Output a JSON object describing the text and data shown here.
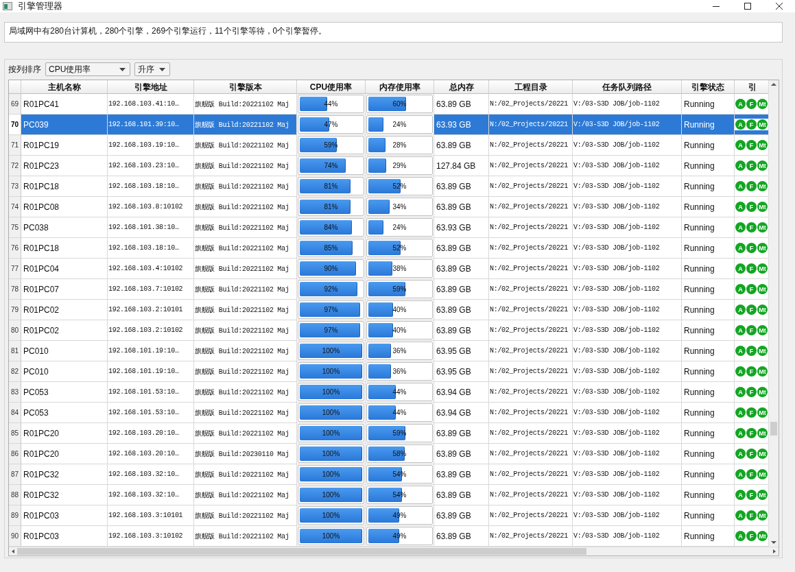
{
  "window": {
    "title": "引擎管理器"
  },
  "summary": "局域网中有280台计算机，280个引擎，269个引擎运行，11个引擎等待，0个引擎暂停。",
  "sort": {
    "label": "按列排序",
    "column": "CPU使用率",
    "order": "升序"
  },
  "table": {
    "columns": [
      "主机名称",
      "引擎地址",
      "引擎版本",
      "CPU使用率",
      "内存使用率",
      "总内存",
      "工程目录",
      "任务队列路径",
      "引擎状态",
      "引"
    ],
    "rows": [
      {
        "number": "69",
        "host": "R01PC41",
        "address": "192.168.103.41:10…",
        "version": "旗舰版 Build:20221102 Maj",
        "cpu": {
          "level": 0.44,
          "text": "44%"
        },
        "memory": {
          "level": 0.6,
          "text": "60%"
        },
        "total": "63.89 GB",
        "project": "N:/02_Projects/20221",
        "queue": "V:/03-S3D JOB/job-1102",
        "status": "Running",
        "badges": [
          "A",
          "F",
          "Mt"
        ],
        "selected": false
      },
      {
        "number": "70",
        "host": "PC039",
        "address": "192.168.101.39:10…",
        "version": "旗舰版 Build:20221102 Maj",
        "cpu": {
          "level": 0.47,
          "text": "47%"
        },
        "memory": {
          "level": 0.24,
          "text": "24%"
        },
        "total": "63.93 GB",
        "project": "N:/02_Projects/20221",
        "queue": "V:/03-S3D JOB/job-1102",
        "status": "Running",
        "badges": [
          "A",
          "F",
          "Mt"
        ],
        "selected": true
      },
      {
        "number": "71",
        "host": "R01PC19",
        "address": "192.168.103.19:10…",
        "version": "旗舰版 Build:20221102 Maj",
        "cpu": {
          "level": 0.59,
          "text": "59%"
        },
        "memory": {
          "level": 0.28,
          "text": "28%"
        },
        "total": "63.89 GB",
        "project": "N:/02_Projects/20221",
        "queue": "V:/03-S3D JOB/job-1102",
        "status": "Running",
        "badges": [
          "A",
          "F",
          "Mt"
        ],
        "selected": false
      },
      {
        "number": "72",
        "host": "R01PC23",
        "address": "192.168.103.23:10…",
        "version": "旗舰版 Build:20221102 Maj",
        "cpu": {
          "level": 0.74,
          "text": "74%"
        },
        "memory": {
          "level": 0.29,
          "text": "29%"
        },
        "total": "127.84 GB",
        "project": "N:/02_Projects/20221",
        "queue": "V:/03-S3D JOB/job-1102",
        "status": "Running",
        "badges": [
          "A",
          "F",
          "Mt"
        ],
        "selected": false
      },
      {
        "number": "73",
        "host": "R01PC18",
        "address": "192.168.103.18:10…",
        "version": "旗舰版 Build:20221102 Maj",
        "cpu": {
          "level": 0.81,
          "text": "81%"
        },
        "memory": {
          "level": 0.52,
          "text": "52%"
        },
        "total": "63.89 GB",
        "project": "N:/02_Projects/20221",
        "queue": "V:/03-S3D JOB/job-1102",
        "status": "Running",
        "badges": [
          "A",
          "F",
          "Mt"
        ],
        "selected": false
      },
      {
        "number": "74",
        "host": "R01PC08",
        "address": "192.168.103.8:10102",
        "version": "旗舰版 Build:20221102 Maj",
        "cpu": {
          "level": 0.81,
          "text": "81%"
        },
        "memory": {
          "level": 0.34,
          "text": "34%"
        },
        "total": "63.89 GB",
        "project": "N:/02_Projects/20221",
        "queue": "V:/03-S3D JOB/job-1102",
        "status": "Running",
        "badges": [
          "A",
          "F",
          "Mt"
        ],
        "selected": false
      },
      {
        "number": "75",
        "host": "PC038",
        "address": "192.168.101.38:10…",
        "version": "旗舰版 Build:20221102 Maj",
        "cpu": {
          "level": 0.84,
          "text": "84%"
        },
        "memory": {
          "level": 0.24,
          "text": "24%"
        },
        "total": "63.93 GB",
        "project": "N:/02_Projects/20221",
        "queue": "V:/03-S3D JOB/job-1102",
        "status": "Running",
        "badges": [
          "A",
          "F",
          "Mt"
        ],
        "selected": false
      },
      {
        "number": "76",
        "host": "R01PC18",
        "address": "192.168.103.18:10…",
        "version": "旗舰版 Build:20221102 Maj",
        "cpu": {
          "level": 0.85,
          "text": "85%"
        },
        "memory": {
          "level": 0.52,
          "text": "52%"
        },
        "total": "63.89 GB",
        "project": "N:/02_Projects/20221",
        "queue": "V:/03-S3D JOB/job-1102",
        "status": "Running",
        "badges": [
          "A",
          "F",
          "Mt"
        ],
        "selected": false
      },
      {
        "number": "77",
        "host": "R01PC04",
        "address": "192.168.103.4:10102",
        "version": "旗舰版 Build:20221102 Maj",
        "cpu": {
          "level": 0.9,
          "text": "90%"
        },
        "memory": {
          "level": 0.38,
          "text": "38%"
        },
        "total": "63.89 GB",
        "project": "N:/02_Projects/20221",
        "queue": "V:/03-S3D JOB/job-1102",
        "status": "Running",
        "badges": [
          "A",
          "F",
          "Mt"
        ],
        "selected": false
      },
      {
        "number": "78",
        "host": "R01PC07",
        "address": "192.168.103.7:10102",
        "version": "旗舰版 Build:20221102 Maj",
        "cpu": {
          "level": 0.92,
          "text": "92%"
        },
        "memory": {
          "level": 0.59,
          "text": "59%"
        },
        "total": "63.89 GB",
        "project": "N:/02_Projects/20221",
        "queue": "V:/03-S3D JOB/job-1102",
        "status": "Running",
        "badges": [
          "A",
          "F",
          "Mt"
        ],
        "selected": false
      },
      {
        "number": "79",
        "host": "R01PC02",
        "address": "192.168.103.2:10101",
        "version": "旗舰版 Build:20221102 Maj",
        "cpu": {
          "level": 0.97,
          "text": "97%"
        },
        "memory": {
          "level": 0.4,
          "text": "40%"
        },
        "total": "63.89 GB",
        "project": "N:/02_Projects/20221",
        "queue": "V:/03-S3D JOB/job-1102",
        "status": "Running",
        "badges": [
          "A",
          "F",
          "Mt"
        ],
        "selected": false
      },
      {
        "number": "80",
        "host": "R01PC02",
        "address": "192.168.103.2:10102",
        "version": "旗舰版 Build:20221102 Maj",
        "cpu": {
          "level": 0.97,
          "text": "97%"
        },
        "memory": {
          "level": 0.4,
          "text": "40%"
        },
        "total": "63.89 GB",
        "project": "N:/02_Projects/20221",
        "queue": "V:/03-S3D JOB/job-1102",
        "status": "Running",
        "badges": [
          "A",
          "F",
          "Mt"
        ],
        "selected": false
      },
      {
        "number": "81",
        "host": "PC010",
        "address": "192.168.101.19:10…",
        "version": "旗舰版 Build:20221102 Maj",
        "cpu": {
          "level": 1,
          "text": "100%"
        },
        "memory": {
          "level": 0.36,
          "text": "36%"
        },
        "total": "63.95 GB",
        "project": "N:/02_Projects/20221",
        "queue": "V:/03-S3D JOB/job-1102",
        "status": "Running",
        "badges": [
          "A",
          "F",
          "Mt"
        ],
        "selected": false
      },
      {
        "number": "82",
        "host": "PC010",
        "address": "192.168.101.19:10…",
        "version": "旗舰版 Build:20221102 Maj",
        "cpu": {
          "level": 1,
          "text": "100%"
        },
        "memory": {
          "level": 0.36,
          "text": "36%"
        },
        "total": "63.95 GB",
        "project": "N:/02_Projects/20221",
        "queue": "V:/03-S3D JOB/job-1102",
        "status": "Running",
        "badges": [
          "A",
          "F",
          "Mt"
        ],
        "selected": false
      },
      {
        "number": "83",
        "host": "PC053",
        "address": "192.168.101.53:10…",
        "version": "旗舰版 Build:20221102 Maj",
        "cpu": {
          "level": 1,
          "text": "100%"
        },
        "memory": {
          "level": 0.44,
          "text": "44%"
        },
        "total": "63.94 GB",
        "project": "N:/02_Projects/20221",
        "queue": "V:/03-S3D JOB/job-1102",
        "status": "Running",
        "badges": [
          "A",
          "F",
          "Mt"
        ],
        "selected": false
      },
      {
        "number": "84",
        "host": "PC053",
        "address": "192.168.101.53:10…",
        "version": "旗舰版 Build:20221102 Maj",
        "cpu": {
          "level": 1,
          "text": "100%"
        },
        "memory": {
          "level": 0.44,
          "text": "44%"
        },
        "total": "63.94 GB",
        "project": "N:/02_Projects/20221",
        "queue": "V:/03-S3D JOB/job-1102",
        "status": "Running",
        "badges": [
          "A",
          "F",
          "Mt"
        ],
        "selected": false
      },
      {
        "number": "85",
        "host": "R01PC20",
        "address": "192.168.103.20:10…",
        "version": "旗舰版 Build:20221102 Maj",
        "cpu": {
          "level": 1,
          "text": "100%"
        },
        "memory": {
          "level": 0.59,
          "text": "59%"
        },
        "total": "63.89 GB",
        "project": "N:/02_Projects/20221",
        "queue": "V:/03-S3D JOB/job-1102",
        "status": "Running",
        "badges": [
          "A",
          "F",
          "Mt"
        ],
        "selected": false
      },
      {
        "number": "86",
        "host": "R01PC20",
        "address": "192.168.103.20:10…",
        "version": "旗舰版 Build:20230110 Maj",
        "cpu": {
          "level": 1,
          "text": "100%"
        },
        "memory": {
          "level": 0.58,
          "text": "58%"
        },
        "total": "63.89 GB",
        "project": "N:/02_Projects/20221",
        "queue": "V:/03-S3D JOB/job-1102",
        "status": "Running",
        "badges": [
          "A",
          "F",
          "Mt"
        ],
        "selected": false
      },
      {
        "number": "87",
        "host": "R01PC32",
        "address": "192.168.103.32:10…",
        "version": "旗舰版 Build:20221102 Maj",
        "cpu": {
          "level": 1,
          "text": "100%"
        },
        "memory": {
          "level": 0.54,
          "text": "54%"
        },
        "total": "63.89 GB",
        "project": "N:/02_Projects/20221",
        "queue": "V:/03-S3D JOB/job-1102",
        "status": "Running",
        "badges": [
          "A",
          "F",
          "Mt"
        ],
        "selected": false
      },
      {
        "number": "88",
        "host": "R01PC32",
        "address": "192.168.103.32:10…",
        "version": "旗舰版 Build:20221102 Maj",
        "cpu": {
          "level": 1,
          "text": "100%"
        },
        "memory": {
          "level": 0.54,
          "text": "54%"
        },
        "total": "63.89 GB",
        "project": "N:/02_Projects/20221",
        "queue": "V:/03-S3D JOB/job-1102",
        "status": "Running",
        "badges": [
          "A",
          "F",
          "Mt"
        ],
        "selected": false
      },
      {
        "number": "89",
        "host": "R01PC03",
        "address": "192.168.103.3:10101",
        "version": "旗舰版 Build:20221102 Maj",
        "cpu": {
          "level": 1,
          "text": "100%"
        },
        "memory": {
          "level": 0.49,
          "text": "49%"
        },
        "total": "63.89 GB",
        "project": "N:/02_Projects/20221",
        "queue": "V:/03-S3D JOB/job-1102",
        "status": "Running",
        "badges": [
          "A",
          "F",
          "Mt"
        ],
        "selected": false
      },
      {
        "number": "90",
        "host": "R01PC03",
        "address": "192.168.103.3:10102",
        "version": "旗舰版 Build:20221102 Maj",
        "cpu": {
          "level": 1,
          "text": "100%"
        },
        "memory": {
          "level": 0.49,
          "text": "49%"
        },
        "total": "63.89 GB",
        "project": "N:/02_Projects/20221",
        "queue": "V:/03-S3D JOB/job-1102",
        "status": "Running",
        "badges": [
          "A",
          "F",
          "Mt"
        ],
        "selected": false
      }
    ]
  }
}
